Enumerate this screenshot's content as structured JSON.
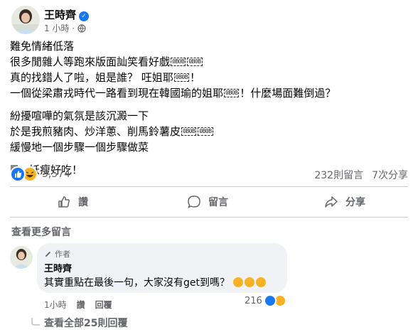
{
  "post": {
    "author": "王時齊",
    "time": "1 小時 ·",
    "lines": [
      "難免情緒低落",
      "很多閒雜人等跑來版面訕笑看好戲",
      "真的找錯人了啦，姐是誰？ 㕵姐耶",
      "一個從梁肅戎時代一路看到現在韓國瑜的姐耶",
      "！什麼場面難倒過？",
      "紛擾喧嘩的氣氛是該沉澱一下",
      "於是我煎豬肉、炒洋蔥、削馬鈴薯皮",
      "緩慢地一個步驟一個步驟做菜",
      "，妖瘦好吃！"
    ],
    "emoji_marker": "0B0B",
    "reaction_count": "3,574",
    "comment_count": "232則留言",
    "share_count": "7次分享"
  },
  "actions": {
    "like": "讚",
    "comment": "留言",
    "share": "分享"
  },
  "comments_section": {
    "view_more": "查看更多留言",
    "comment": {
      "badge": "作者",
      "author": "王時齊",
      "text": "其實重點在最後一句，大家沒有get到嗎？",
      "time": "1小時",
      "like": "讚",
      "reply": "回覆",
      "reaction_count": "216"
    },
    "view_replies": "查看全部25則回覆"
  },
  "colors": {
    "like_blue": "#1877f2",
    "haha_yellow": "#f7b125",
    "meta_gray": "#65676b",
    "bubble_bg": "#f0f2f5"
  }
}
